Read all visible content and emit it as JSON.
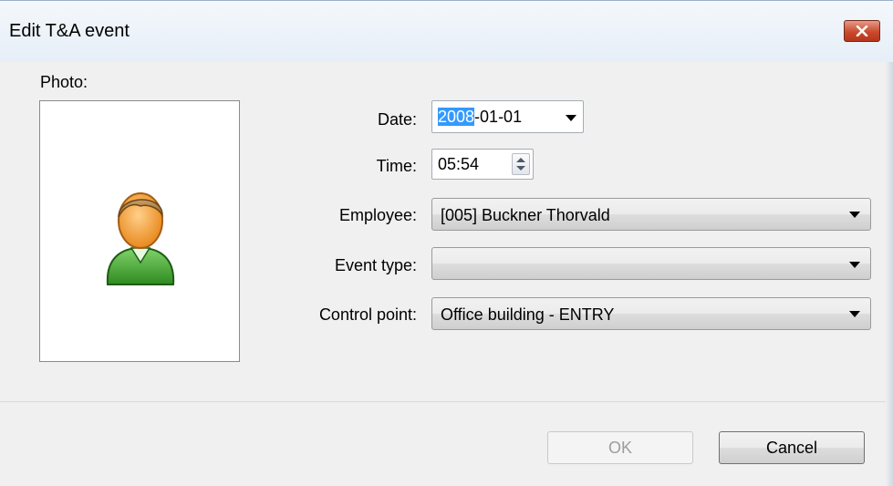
{
  "window": {
    "title": "Edit T&A event",
    "close_icon": "close-x-icon"
  },
  "photo": {
    "label": "Photo:",
    "icon": "user-avatar-icon"
  },
  "form": {
    "date": {
      "label": "Date:",
      "value_selected": "2008",
      "value_rest": "-01-01"
    },
    "time": {
      "label": "Time:",
      "value": "05:54"
    },
    "employee": {
      "label": "Employee:",
      "value": "[005]  Buckner Thorvald"
    },
    "event_type": {
      "label": "Event type:",
      "value": ""
    },
    "control_point": {
      "label": "Control point:",
      "value": "Office building - ENTRY"
    }
  },
  "buttons": {
    "ok": "OK",
    "cancel": "Cancel"
  },
  "colors": {
    "selection": "#3399ff",
    "close_button": "#c94a2c"
  }
}
